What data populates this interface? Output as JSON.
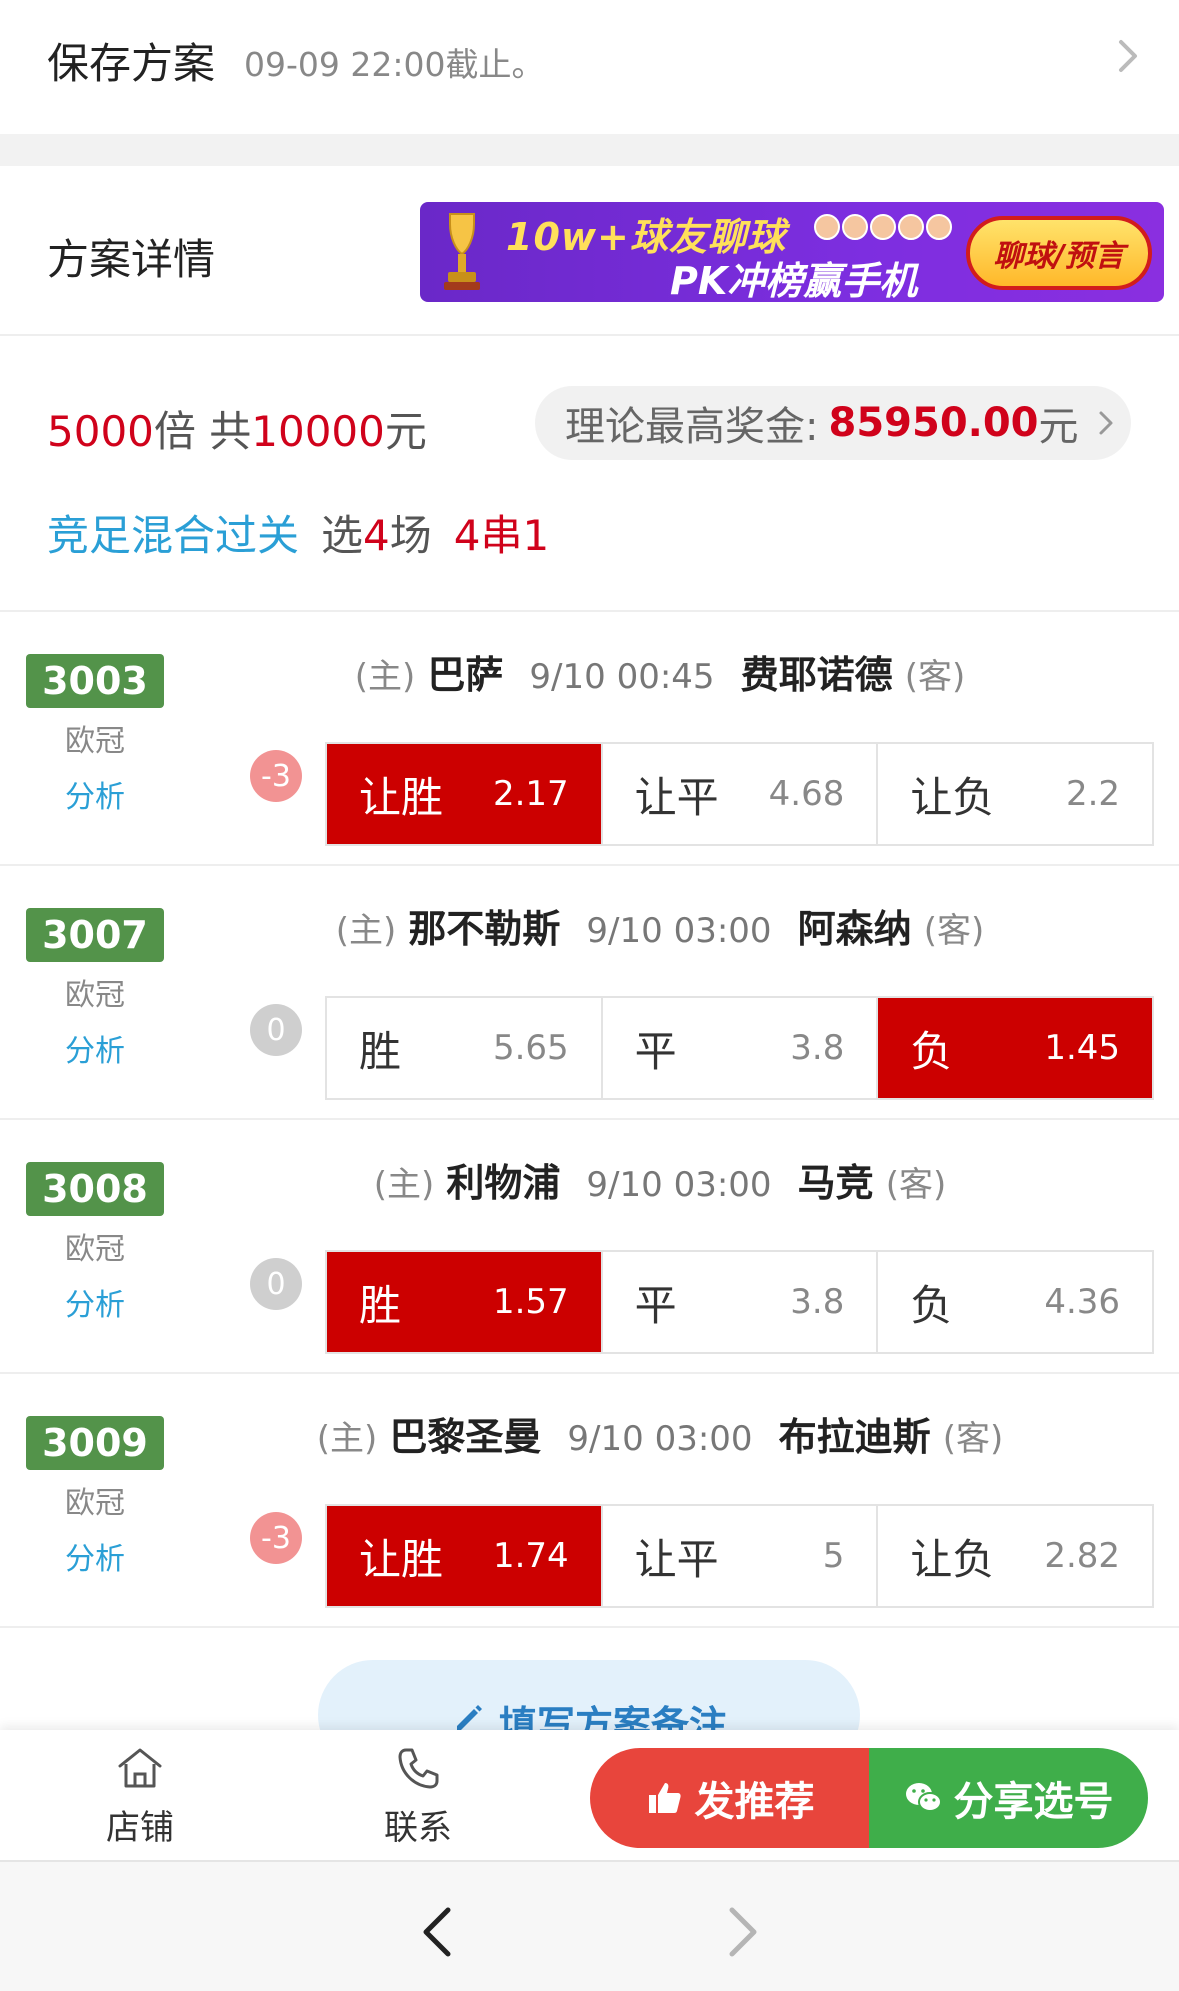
{
  "header": {
    "title": "保存方案",
    "deadline": "09-09 22:00截止。"
  },
  "detail": {
    "title": "方案详情",
    "banner": {
      "line1": "10w+球友聊球",
      "line2": "PK冲榜赢手机",
      "pill": "聊球/预言"
    }
  },
  "summary": {
    "multiplier_value": "5000",
    "multiplier_unit": "倍 共",
    "total_value": "10000",
    "total_unit": "元",
    "prize_label": "理论最高奖金:",
    "prize_amount": "85950.00",
    "prize_unit": "元",
    "play_type": "竞足混合过关",
    "select_prefix": "选",
    "select_count": "4",
    "select_suffix": "场",
    "pass_type": "4串1"
  },
  "matches": [
    {
      "code": "3003",
      "league": "欧冠",
      "analysis": "分析",
      "home_tag": "(主)",
      "home": "巴萨",
      "time": "9/10 00:45",
      "away": "费耶诺德",
      "away_tag": "(客)",
      "handicap": "-3",
      "odds": [
        {
          "label": "让胜",
          "value": "2.17",
          "selected": true
        },
        {
          "label": "让平",
          "value": "4.68",
          "selected": false
        },
        {
          "label": "让负",
          "value": "2.2",
          "selected": false
        }
      ]
    },
    {
      "code": "3007",
      "league": "欧冠",
      "analysis": "分析",
      "home_tag": "(主)",
      "home": "那不勒斯",
      "time": "9/10 03:00",
      "away": "阿森纳",
      "away_tag": "(客)",
      "handicap": "0",
      "odds": [
        {
          "label": "胜",
          "value": "5.65",
          "selected": false
        },
        {
          "label": "平",
          "value": "3.8",
          "selected": false
        },
        {
          "label": "负",
          "value": "1.45",
          "selected": true
        }
      ]
    },
    {
      "code": "3008",
      "league": "欧冠",
      "analysis": "分析",
      "home_tag": "(主)",
      "home": "利物浦",
      "time": "9/10 03:00",
      "away": "马竞",
      "away_tag": "(客)",
      "handicap": "0",
      "odds": [
        {
          "label": "胜",
          "value": "1.57",
          "selected": true
        },
        {
          "label": "平",
          "value": "3.8",
          "selected": false
        },
        {
          "label": "负",
          "value": "4.36",
          "selected": false
        }
      ]
    },
    {
      "code": "3009",
      "league": "欧冠",
      "analysis": "分析",
      "home_tag": "(主)",
      "home": "巴黎圣曼",
      "time": "9/10 03:00",
      "away": "布拉迪斯",
      "away_tag": "(客)",
      "handicap": "-3",
      "odds": [
        {
          "label": "让胜",
          "value": "1.74",
          "selected": true
        },
        {
          "label": "让平",
          "value": "5",
          "selected": false
        },
        {
          "label": "让负",
          "value": "2.82",
          "selected": false
        }
      ]
    }
  ],
  "note_button": "填写方案备注",
  "bottom_bar": {
    "shop": "店铺",
    "contact": "联系",
    "recommend": "发推荐",
    "share": "分享选号"
  },
  "colors": {
    "selected_bg": "#cc0000",
    "code_badge": "#53934a",
    "link_blue": "#2a9fd6",
    "red_text": "#d0021b",
    "recommend_btn": "#e8453c",
    "share_btn": "#3fae4a"
  },
  "icons": {
    "header_chevron": "chevron-right-icon",
    "shop": "home-icon",
    "contact": "phone-icon",
    "recommend": "thumbs-up-icon",
    "share": "wechat-icon",
    "note": "pencil-icon",
    "nav_back": "chevron-left-icon",
    "nav_forward": "chevron-right-icon"
  }
}
